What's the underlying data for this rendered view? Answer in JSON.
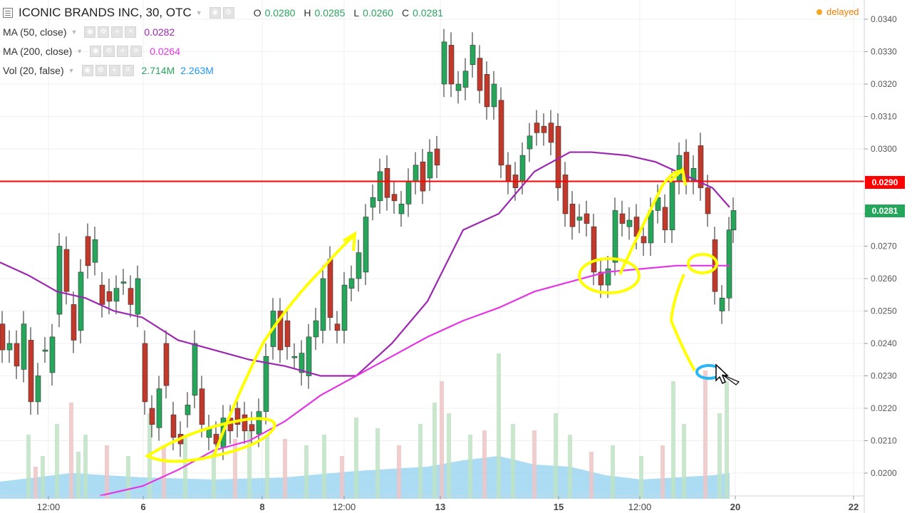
{
  "header": {
    "title": "ICONIC BRANDS INC, 30, OTC",
    "ohlc": [
      {
        "key": "O",
        "value": "0.0280"
      },
      {
        "key": "H",
        "value": "0.0285"
      },
      {
        "key": "L",
        "value": "0.0260"
      },
      {
        "key": "C",
        "value": "0.0281"
      }
    ],
    "status": "delayed"
  },
  "indicators": [
    {
      "name": "MA (50, close)",
      "values": [
        "0.0282"
      ],
      "colors": [
        "#9c27b0"
      ]
    },
    {
      "name": "MA (200, close)",
      "values": [
        "0.0264"
      ],
      "colors": [
        "#e535e5"
      ]
    },
    {
      "name": "Vol (20, false)",
      "values": [
        "2.714M",
        "2.263M"
      ],
      "colors": [
        "#26a65b",
        "#2196f3"
      ]
    }
  ],
  "price_labels": {
    "resistance": "0.0290",
    "last": "0.0281"
  },
  "colors": {
    "up": "#26a65b",
    "down": "#c0392b",
    "ma50": "#9c27b0",
    "ma200": "#e535e5",
    "resistance": "#ff0000",
    "last": "#26a65b",
    "annotation": "#ffff00",
    "cursor_circle": "#29b6f6"
  },
  "chart_data": {
    "type": "candlestick",
    "yticks": [
      "0.0200",
      "0.0210",
      "0.0220",
      "0.0230",
      "0.0240",
      "0.0250",
      "0.0260",
      "0.0270",
      "0.0280",
      "0.0290",
      "0.0300",
      "0.0310",
      "0.0320",
      "0.0330",
      "0.0340"
    ],
    "ylim": [
      0.0193,
      0.0342
    ],
    "xticks": [
      "12:00",
      "6",
      "8",
      "12:00",
      "13",
      "15",
      "12:00",
      "20",
      "22"
    ],
    "resistance": 0.029,
    "last": 0.0281,
    "grid": true,
    "series": [
      {
        "name": "MA (50, close)",
        "points": [
          [
            0,
            0.0265
          ],
          [
            40,
            0.0261
          ],
          [
            80,
            0.0256
          ],
          [
            120,
            0.0254
          ],
          [
            160,
            0.025
          ],
          [
            200,
            0.0248
          ],
          [
            250,
            0.0241
          ],
          [
            300,
            0.0238
          ],
          [
            350,
            0.0235
          ],
          [
            400,
            0.0233
          ],
          [
            450,
            0.023
          ],
          [
            500,
            0.023
          ],
          [
            550,
            0.024
          ],
          [
            600,
            0.0253
          ],
          [
            650,
            0.0275
          ],
          [
            700,
            0.028
          ],
          [
            750,
            0.0293
          ],
          [
            800,
            0.0299
          ],
          [
            830,
            0.0299
          ],
          [
            880,
            0.0298
          ],
          [
            920,
            0.0296
          ],
          [
            960,
            0.0292
          ],
          [
            1000,
            0.0288
          ],
          [
            1024,
            0.0282
          ]
        ]
      },
      {
        "name": "MA (200, close)",
        "points": [
          [
            140,
            0.0193
          ],
          [
            200,
            0.0196
          ],
          [
            250,
            0.0201
          ],
          [
            300,
            0.0207
          ],
          [
            350,
            0.021
          ],
          [
            400,
            0.0216
          ],
          [
            450,
            0.0224
          ],
          [
            500,
            0.023
          ],
          [
            550,
            0.0236
          ],
          [
            600,
            0.0242
          ],
          [
            650,
            0.0247
          ],
          [
            700,
            0.0251
          ],
          [
            750,
            0.0256
          ],
          [
            800,
            0.0259
          ],
          [
            850,
            0.0262
          ],
          [
            900,
            0.0263
          ],
          [
            950,
            0.0264
          ],
          [
            1024,
            0.0264
          ]
        ]
      }
    ],
    "candles": [
      [
        0,
        0.0246,
        0.0238
      ],
      [
        10,
        0.0238,
        0.024
      ],
      [
        20,
        0.024,
        0.0233
      ],
      [
        30,
        0.0232,
        0.0246
      ],
      [
        40,
        0.0241,
        0.0222
      ],
      [
        50,
        0.0222,
        0.023
      ],
      [
        60,
        0.0238,
        0.0238
      ],
      [
        70,
        0.0231,
        0.0242
      ],
      [
        80,
        0.0249,
        0.027
      ],
      [
        90,
        0.0269,
        0.0256
      ],
      [
        100,
        0.0252,
        0.0241
      ],
      [
        110,
        0.0244,
        0.0262
      ],
      [
        120,
        0.0273,
        0.0264
      ],
      [
        130,
        0.0265,
        0.0272
      ],
      [
        140,
        0.0258,
        0.0252
      ],
      [
        150,
        0.0256,
        0.0253
      ],
      [
        160,
        0.0253,
        0.0257
      ],
      [
        170,
        0.0259,
        0.0259
      ],
      [
        180,
        0.0257,
        0.0252
      ],
      [
        190,
        0.0249,
        0.026
      ],
      [
        200,
        0.024,
        0.0222
      ],
      [
        210,
        0.022,
        0.0215
      ],
      [
        220,
        0.0214,
        0.0226
      ],
      [
        230,
        0.024,
        0.0227
      ],
      [
        240,
        0.0218,
        0.0211
      ],
      [
        250,
        0.0212,
        0.0209
      ],
      [
        260,
        0.0218,
        0.0221
      ],
      [
        270,
        0.0224,
        0.024
      ],
      [
        280,
        0.0226,
        0.0215
      ],
      [
        290,
        0.0211,
        0.0214
      ],
      [
        300,
        0.0212,
        0.0209
      ],
      [
        310,
        0.0208,
        0.0217
      ],
      [
        320,
        0.0217,
        0.0213
      ],
      [
        330,
        0.022,
        0.0215
      ],
      [
        340,
        0.0218,
        0.0213
      ],
      [
        350,
        0.0215,
        0.0213
      ],
      [
        360,
        0.0212,
        0.0219
      ],
      [
        370,
        0.0219,
        0.0236
      ],
      [
        380,
        0.0239,
        0.025
      ],
      [
        390,
        0.025,
        0.0238
      ],
      [
        400,
        0.0247,
        0.0239
      ],
      [
        410,
        0.0236,
        0.0236
      ],
      [
        420,
        0.0231,
        0.0237
      ],
      [
        430,
        0.023,
        0.0242
      ],
      [
        440,
        0.0242,
        0.0247
      ],
      [
        450,
        0.0244,
        0.026
      ],
      [
        460,
        0.0266,
        0.0248
      ],
      [
        470,
        0.0246,
        0.0244
      ],
      [
        480,
        0.0244,
        0.0258
      ],
      [
        490,
        0.0257,
        0.026
      ],
      [
        500,
        0.026,
        0.0268
      ],
      [
        510,
        0.0262,
        0.0279
      ],
      [
        520,
        0.0282,
        0.0285
      ],
      [
        530,
        0.0284,
        0.0293
      ],
      [
        540,
        0.0294,
        0.0285
      ],
      [
        550,
        0.0286,
        0.0284
      ],
      [
        560,
        0.028,
        0.0283
      ],
      [
        570,
        0.0283,
        0.029
      ],
      [
        580,
        0.029,
        0.0295
      ],
      [
        590,
        0.0296,
        0.0287
      ],
      [
        600,
        0.0291,
        0.0299
      ],
      [
        610,
        0.03,
        0.0295
      ],
      [
        620,
        0.032,
        0.0333
      ],
      [
        630,
        0.0332,
        0.032
      ],
      [
        640,
        0.0318,
        0.032
      ],
      [
        650,
        0.0319,
        0.0324
      ],
      [
        660,
        0.0326,
        0.0332
      ],
      [
        670,
        0.0328,
        0.0318
      ],
      [
        680,
        0.0323,
        0.0313
      ],
      [
        690,
        0.0313,
        0.032
      ],
      [
        700,
        0.0315,
        0.0295
      ],
      [
        710,
        0.0295,
        0.029
      ],
      [
        720,
        0.0292,
        0.0288
      ],
      [
        730,
        0.029,
        0.0298
      ],
      [
        740,
        0.03,
        0.0304
      ],
      [
        750,
        0.0308,
        0.0305
      ],
      [
        760,
        0.0307,
        0.0305
      ],
      [
        770,
        0.0308,
        0.0302
      ],
      [
        780,
        0.0307,
        0.0288
      ],
      [
        790,
        0.0292,
        0.028
      ],
      [
        800,
        0.0283,
        0.0276
      ],
      [
        810,
        0.0278,
        0.0279
      ],
      [
        820,
        0.028,
        0.0277
      ],
      [
        830,
        0.0276,
        0.0262
      ],
      [
        840,
        0.0262,
        0.0258
      ],
      [
        850,
        0.0258,
        0.0263
      ],
      [
        860,
        0.0265,
        0.0281
      ],
      [
        870,
        0.028,
        0.0277
      ],
      [
        880,
        0.0276,
        0.0278
      ],
      [
        890,
        0.0279,
        0.0273
      ],
      [
        900,
        0.0273,
        0.0271
      ],
      [
        910,
        0.0271,
        0.0281
      ],
      [
        920,
        0.0281,
        0.0285
      ],
      [
        930,
        0.0282,
        0.0275
      ],
      [
        940,
        0.0275,
        0.029
      ],
      [
        950,
        0.029,
        0.0298
      ],
      [
        960,
        0.0299,
        0.029
      ],
      [
        970,
        0.029,
        0.0294
      ],
      [
        980,
        0.0301,
        0.0288
      ],
      [
        990,
        0.0288,
        0.028
      ],
      [
        1000,
        0.0272,
        0.0256
      ],
      [
        1010,
        0.025,
        0.0254
      ],
      [
        1020,
        0.0254,
        0.0275
      ],
      [
        1026,
        0.0275,
        0.0281
      ]
    ],
    "volume": [
      [
        40,
        0.3
      ],
      [
        50,
        0.15
      ],
      [
        60,
        0.2
      ],
      [
        80,
        0.35
      ],
      [
        100,
        0.45
      ],
      [
        110,
        0.22
      ],
      [
        120,
        0.3
      ],
      [
        150,
        0.25
      ],
      [
        180,
        0.2
      ],
      [
        210,
        0.4
      ],
      [
        230,
        0.25
      ],
      [
        260,
        0.3
      ],
      [
        300,
        0.22
      ],
      [
        330,
        0.28
      ],
      [
        350,
        0.32
      ],
      [
        375,
        0.3
      ],
      [
        400,
        0.28
      ],
      [
        430,
        0.25
      ],
      [
        455,
        0.3
      ],
      [
        480,
        0.2
      ],
      [
        500,
        0.38
      ],
      [
        530,
        0.33
      ],
      [
        560,
        0.25
      ],
      [
        590,
        0.35
      ],
      [
        610,
        0.45
      ],
      [
        620,
        0.55
      ],
      [
        630,
        0.4
      ],
      [
        660,
        0.3
      ],
      [
        680,
        0.32
      ],
      [
        700,
        0.68
      ],
      [
        720,
        0.35
      ],
      [
        750,
        0.32
      ],
      [
        780,
        0.4
      ],
      [
        800,
        0.3
      ],
      [
        830,
        0.22
      ],
      [
        860,
        0.25
      ],
      [
        900,
        0.2
      ],
      [
        930,
        0.25
      ],
      [
        945,
        0.55
      ],
      [
        960,
        0.35
      ],
      [
        990,
        0.6
      ],
      [
        1010,
        0.4
      ],
      [
        1020,
        0.55
      ]
    ],
    "volume_ma": [
      [
        0,
        0.08
      ],
      [
        100,
        0.12
      ],
      [
        200,
        0.1
      ],
      [
        300,
        0.09
      ],
      [
        400,
        0.1
      ],
      [
        500,
        0.13
      ],
      [
        600,
        0.15
      ],
      [
        650,
        0.18
      ],
      [
        700,
        0.2
      ],
      [
        750,
        0.16
      ],
      [
        800,
        0.15
      ],
      [
        850,
        0.11
      ],
      [
        900,
        0.09
      ],
      [
        950,
        0.1
      ],
      [
        1000,
        0.11
      ],
      [
        1024,
        0.12
      ]
    ]
  }
}
